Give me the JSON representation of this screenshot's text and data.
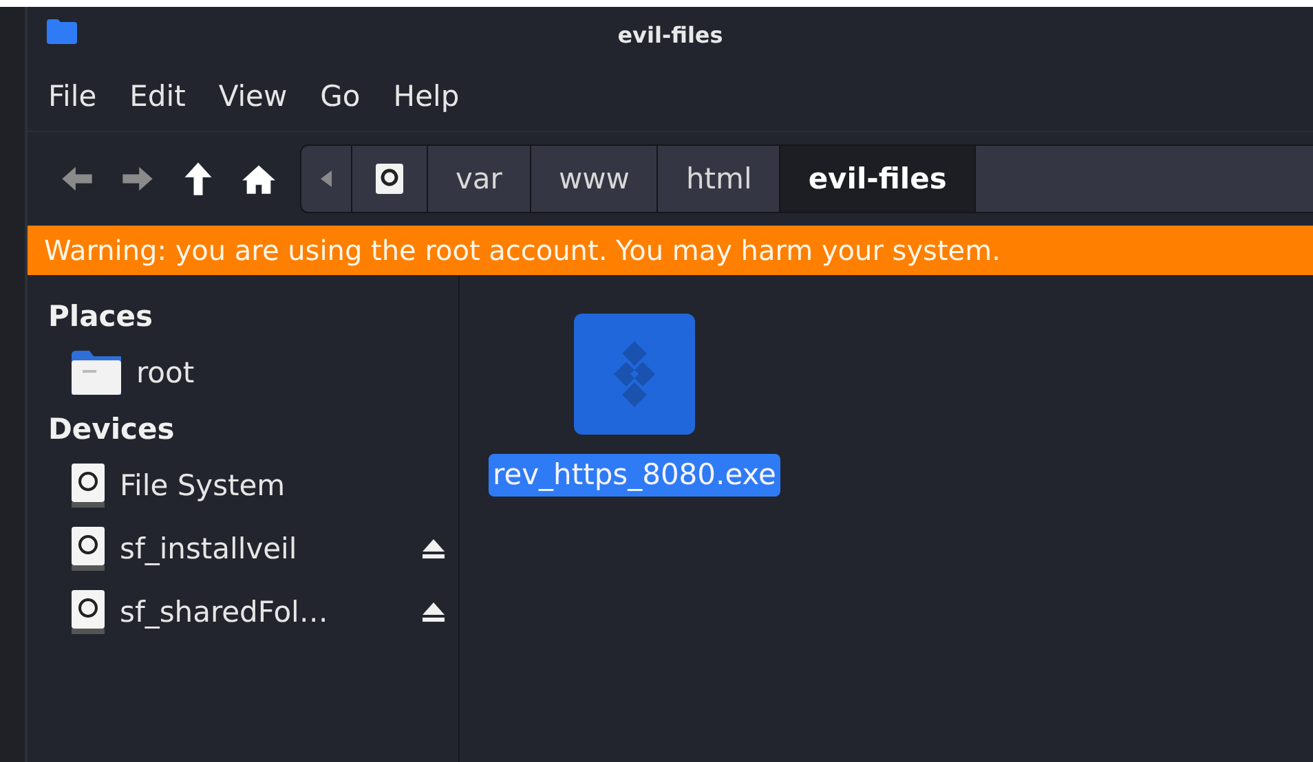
{
  "window": {
    "title": "evil-files"
  },
  "menu": [
    "File",
    "Edit",
    "View",
    "Go",
    "Help"
  ],
  "toolbar": {
    "nav": [
      {
        "kind": "back",
        "disabled": true
      },
      {
        "kind": "forward",
        "disabled": true
      },
      {
        "kind": "up",
        "disabled": false
      },
      {
        "kind": "home",
        "disabled": false
      }
    ],
    "path": [
      {
        "label": "var",
        "selected": false
      },
      {
        "label": "www",
        "selected": false
      },
      {
        "label": "html",
        "selected": false
      },
      {
        "label": "evil-files",
        "selected": true
      }
    ]
  },
  "warning": "Warning: you are using the root account. You may harm your system.",
  "sidebar": [
    {
      "heading": "Places",
      "items": [
        {
          "kind": "folder",
          "label": "root",
          "ejectable": false
        }
      ]
    },
    {
      "heading": "Devices",
      "items": [
        {
          "kind": "drive",
          "label": "File System",
          "ejectable": false
        },
        {
          "kind": "drive",
          "label": "sf_installveil",
          "ejectable": true
        },
        {
          "kind": "drive",
          "label": "sf_sharedFol…",
          "ejectable": true
        }
      ]
    }
  ],
  "files": [
    {
      "name": "rev_https_8080.exe",
      "selected": true
    }
  ]
}
